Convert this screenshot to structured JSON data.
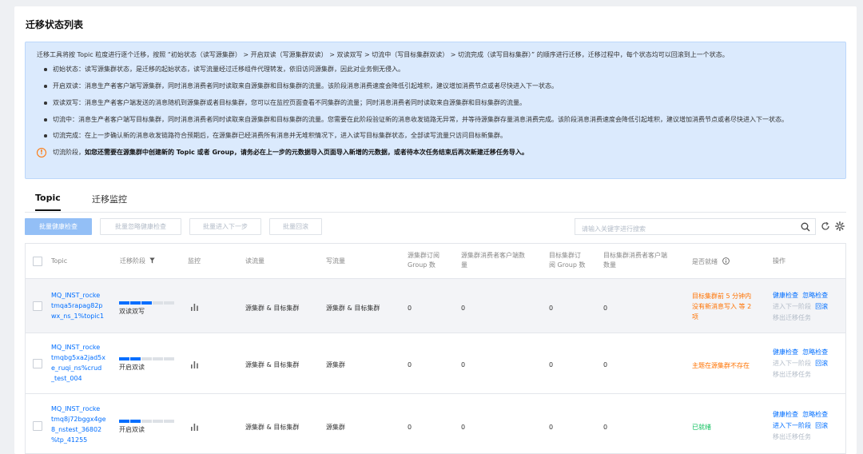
{
  "page": {
    "title": "迁移状态列表"
  },
  "info": {
    "intro": "迁移工具将按 Topic 粒度进行逐个迁移，按照 “初始状态（读写源集群） > 开启双读（写源集群双读） > 双读双写 > 切流中（写目标集群双读） > 切流完成（读写目标集群）” 的顺序进行迁移，迁移过程中，每个状态均可以回滚到上一个状态。",
    "bullets": [
      "初始状态：读写源集群状态，是迁移的起始状态，读写流量经过迁移组件代理转发，依旧访问源集群，因此对业务侧无侵入。",
      "开启双读：消息生产者客户端写源集群，同时消息消费者同时读取来自源集群和目标集群的流量。该阶段消息消费速度会降低引起堆积，建议增加消费节点或者尽快进入下一状态。",
      "双读双写：消息生产者客户端发送的消息随机到源集群或者目标集群，您可以在监控页面查看不同集群的流量；同时消息消费者同时读取来自源集群和目标集群的流量。",
      "切流中：消息生产者客户端写目标集群，同时消息消费者同时读取来自源集群和目标集群的流量。您需要在此阶段验证新的消息收发链路无异常，并等待源集群存量消息消费完成。该阶段消息消费速度会降低引起堆积，建议增加消费节点或者尽快进入下一状态。",
      "切流完成：在上一步确认新的消息收发链路符合预期后，在源集群已经消费所有消息并无堆积情况下，进入读写目标集群状态，全部读写流量只访问目标新集群。"
    ],
    "warn_prefix": "切流阶段，",
    "warn_bold": "如您还需要在源集群中创建新的 Topic 或者 Group，请务必在上一步的元数据导入页面导入新增的元数据，或者待本次任务结束后再次新建迁移任务导入。"
  },
  "tabs": [
    {
      "label": "Topic",
      "active": true
    },
    {
      "label": "迁移监控",
      "active": false
    }
  ],
  "toolbar": {
    "buttons": [
      "批量健康检查",
      "批量忽略健康检查",
      "批量进入下一步",
      "批量回滚"
    ],
    "search_placeholder": "请输入关键字进行搜索",
    "icons": [
      "search-icon",
      "refresh-icon",
      "settings-icon"
    ]
  },
  "table": {
    "headers": {
      "topic": "Topic",
      "stage": "迁移阶段",
      "monitor": "监控",
      "read_flow": "读流量",
      "write_flow": "写流量",
      "src_group_line1": "源集群订阅",
      "src_group_line2": "Group 数",
      "src_client_line1": "源集群消费者客户端数",
      "src_client_line2": "量",
      "dst_group_line1": "目标集群订",
      "dst_group_line2": "阅 Group 数",
      "dst_client_line1": "目标集群消费者客户端",
      "dst_client_line2": "数量",
      "ready": "是否就绪",
      "ops": "操作"
    },
    "rows": [
      {
        "topic_lines": [
          "MQ_INST_rocke",
          "tmqa5rapag82p",
          "wx_ns_1%topic1"
        ],
        "stage": "双读双写",
        "progress_filled": 3,
        "progress_total": 5,
        "read_flow": "源集群 & 目标集群",
        "write_flow": "源集群 & 目标集群",
        "src_groups": "0",
        "src_clients": "0",
        "dst_groups": "0",
        "dst_clients": "0",
        "ready_lines": [
          "目标集群前 5 分钟内",
          "没有新消息写入 等 2",
          "项"
        ],
        "ready_status": "warn",
        "ops_line1": [
          "健康检查",
          "忽略检查"
        ],
        "ops_line2": [
          "进入下一阶段",
          "回滚"
        ],
        "ops_line3": "移出迁移任务"
      },
      {
        "topic_lines": [
          "MQ_INST_rocke",
          "tmqbg5xa2jad5x",
          "e_ruqi_ns%crud",
          "_test_004"
        ],
        "stage": "开启双读",
        "progress_filled": 2,
        "progress_total": 5,
        "read_flow": "源集群 & 目标集群",
        "write_flow": "源集群",
        "src_groups": "0",
        "src_clients": "0",
        "dst_groups": "0",
        "dst_clients": "0",
        "ready_lines": [
          "主题在源集群不存在"
        ],
        "ready_status": "warn",
        "ops_line1": [
          "健康检查",
          "忽略检查"
        ],
        "ops_line2": [
          "进入下一阶段",
          "回滚"
        ],
        "ops_line3": "移出迁移任务"
      },
      {
        "topic_lines": [
          "MQ_INST_rocke",
          "tmq8j72bggx4ge",
          "8_nstest_36802",
          "%tp_41255"
        ],
        "stage": "开启双读",
        "progress_filled": 2,
        "progress_total": 5,
        "read_flow": "源集群 & 目标集群",
        "write_flow": "源集群",
        "src_groups": "0",
        "src_clients": "0",
        "dst_groups": "0",
        "dst_clients": "0",
        "ready_lines": [
          "已就绪"
        ],
        "ready_status": "ok",
        "ops_line1": [
          "健康检查",
          "忽略检查"
        ],
        "ops_line2": [
          "进入下一阶段",
          "回滚"
        ],
        "ops_line3": "移出迁移任务"
      }
    ]
  },
  "colors": {
    "accent": "#006eff",
    "warning": "#ff7200",
    "success": "#0abf5b",
    "info_bg": "#dbeafd"
  }
}
